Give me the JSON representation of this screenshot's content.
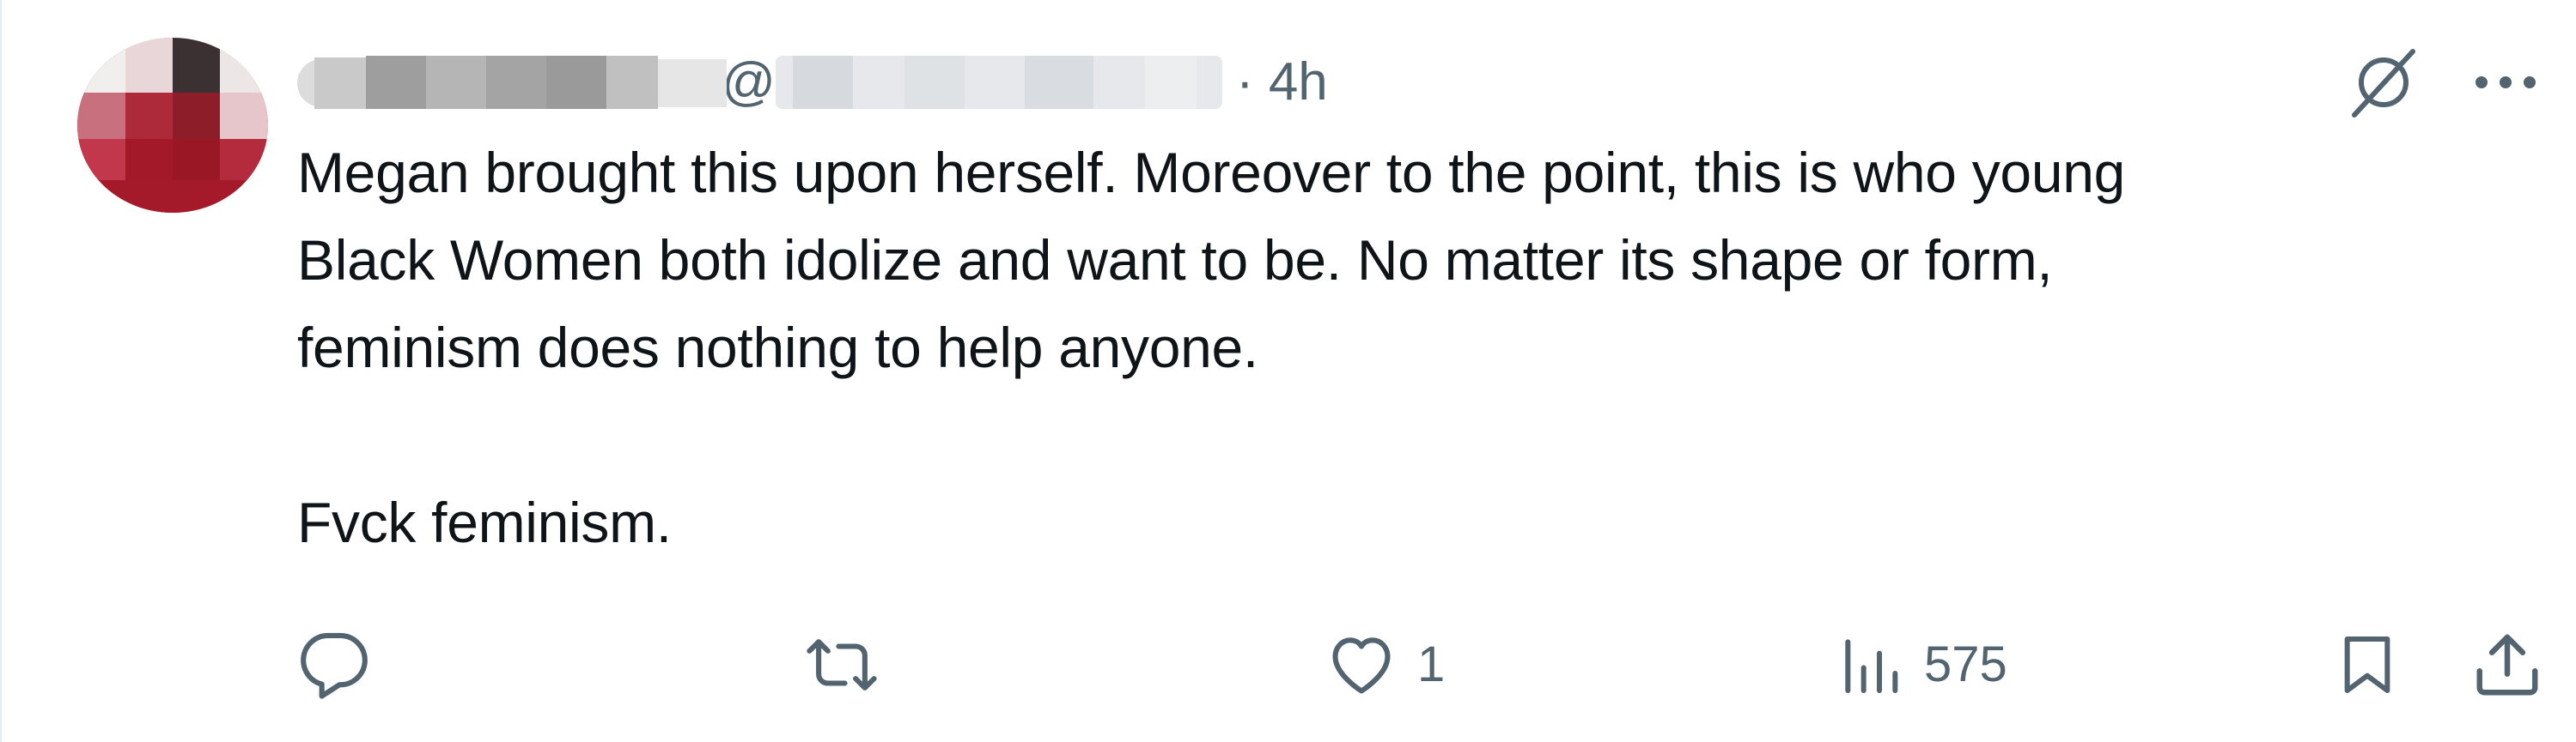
{
  "post": {
    "timestamp": "· 4h",
    "at_symbol": "@",
    "text_lines": [
      "Megan brought this upon herself. Moreover to the point, this is who young",
      "Black Women both idolize and want to be. No matter its shape or form,",
      "feminism does nothing to help anyone.",
      "Fvck feminism."
    ]
  },
  "actions": {
    "reply_count": "",
    "repost_count": "",
    "like_count": "1",
    "views_count": "575"
  },
  "icons": {
    "grok": "grok-icon",
    "more": "more-icon",
    "reply": "reply-icon",
    "repost": "repost-icon",
    "like": "heart-icon",
    "views": "views-icon",
    "bookmark": "bookmark-icon",
    "share": "share-icon"
  },
  "colors": {
    "text": "#0f1419",
    "secondary": "#536471",
    "avatar_red": "#a31826"
  }
}
